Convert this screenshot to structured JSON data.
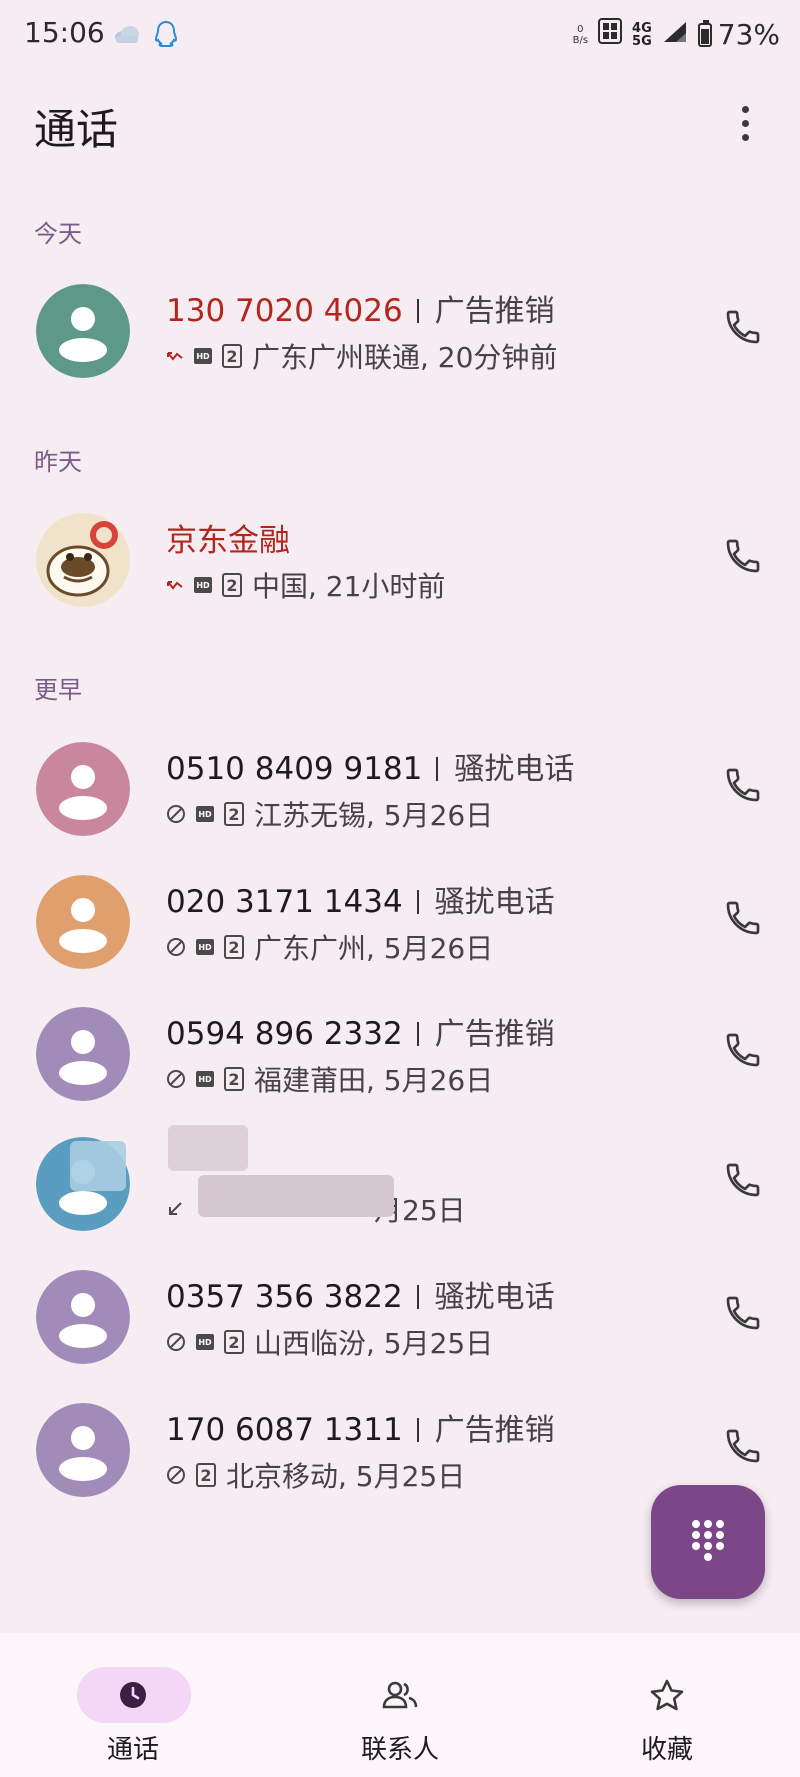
{
  "status_bar": {
    "time": "15:06",
    "icons": [
      "cloud-icon",
      "qq-icon"
    ],
    "net_speed_value": "0",
    "net_speed_unit": "B/s",
    "network_1": "4G",
    "network_2": "5G",
    "battery": "73%",
    "battery_level": 0.73
  },
  "header": {
    "title": "通话"
  },
  "sections": {
    "today": "今天",
    "yesterday": "昨天",
    "earlier": "更早"
  },
  "calls": [
    {
      "name": "130 7020 4026",
      "tag": "广告推销",
      "sim": "2",
      "detail": "广东广州联通, 20分钟前",
      "missed": true,
      "avatar_color": "#5e9988",
      "direction_icon": "missed-call-icon"
    },
    {
      "name": "京东金融",
      "tag": "",
      "sim": "2",
      "detail": "中国, 21小时前",
      "missed": true,
      "avatar_color": "#e9d5b4",
      "direction_icon": "missed-call-icon"
    },
    {
      "name": "0510 8409 9181",
      "tag": "骚扰电话",
      "sim": "2",
      "detail": "江苏无锡, 5月26日",
      "missed": false,
      "avatar_color": "#c9879d",
      "direction_icon": "blocked-call-icon"
    },
    {
      "name": "020 3171 1434",
      "tag": "骚扰电话",
      "sim": "2",
      "detail": "广东广州, 5月26日",
      "missed": false,
      "avatar_color": "#e0a06e",
      "direction_icon": "blocked-call-icon"
    },
    {
      "name": "0594 896 2332",
      "tag": "广告推销",
      "sim": "2",
      "detail": "福建莆田, 5月26日",
      "missed": false,
      "avatar_color": "#a18bb8",
      "direction_icon": "blocked-call-icon"
    },
    {
      "name": "",
      "tag": "",
      "sim": "",
      "detail": "月25日",
      "missed": false,
      "avatar_color": "#5a9dc0",
      "direction_icon": "incoming-call-icon"
    },
    {
      "name": "0357 356 3822",
      "tag": "骚扰电话",
      "sim": "2",
      "detail": "山西临汾, 5月25日",
      "missed": false,
      "avatar_color": "#a18bb8",
      "direction_icon": "blocked-call-icon"
    },
    {
      "name": "170 6087 1311",
      "tag": "广告推销",
      "sim": "2",
      "detail": "北京移动, 5月25日",
      "missed": false,
      "avatar_color": "#a18bb8",
      "direction_icon": "blocked-call-icon"
    }
  ],
  "hd_label": "HD",
  "fab": {
    "icon": "dialpad-icon"
  },
  "bottom_nav": [
    {
      "label": "通话",
      "icon": "clock-icon",
      "active": true
    },
    {
      "label": "联系人",
      "icon": "people-icon",
      "active": false
    },
    {
      "label": "收藏",
      "icon": "star-icon",
      "active": false
    }
  ],
  "colors": {
    "accent": "#7c4788",
    "missed": "#b3261e",
    "section": "#7c5b88",
    "background": "#f6edf2"
  }
}
